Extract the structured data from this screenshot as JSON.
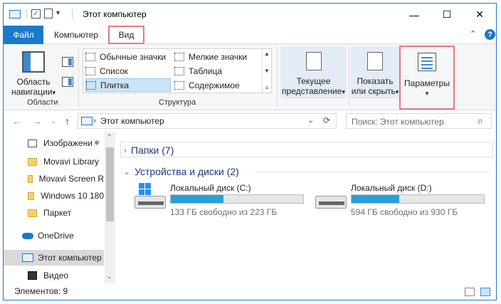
{
  "window": {
    "title": "Этот компьютер",
    "controls": {
      "minimize": "—",
      "maximize": "☐",
      "close": "✕"
    }
  },
  "ribbon_tabs": {
    "file": "Файл",
    "computer": "Компьютер",
    "view": "Вид",
    "collapse_glyph": "⌃",
    "help_glyph": "?"
  },
  "ribbon": {
    "panes_group": {
      "nav_pane_label_1": "Область",
      "nav_pane_label_2": "навигации",
      "dropdown": "▾",
      "group_label": "Области"
    },
    "layout_group": {
      "items": [
        "Обычные значки",
        "Мелкие значки",
        "Список",
        "Таблица",
        "Плитка",
        "Содержимое"
      ],
      "selected": "Плитка",
      "group_label": "Структура"
    },
    "current_view": {
      "label_1": "Текущее",
      "label_2": "представление",
      "dropdown": "▾"
    },
    "show_hide": {
      "label_1": "Показать",
      "label_2": "или скрыть",
      "dropdown": "▾"
    },
    "options": {
      "label": "Параметры",
      "dropdown": "▾"
    }
  },
  "address_bar": {
    "back": "←",
    "forward": "→",
    "recent": "⌄",
    "up": "↑",
    "separator": "›",
    "path": "Этот компьютер",
    "dropdown": "⌄",
    "refresh": "⟳",
    "search_placeholder": "Поиск: Этот компьютер",
    "search_icon": "⌕"
  },
  "sidebar": {
    "items": [
      {
        "label": "Изображени",
        "icon": "pictures-icon",
        "pinned": true
      },
      {
        "label": "Movavi Library",
        "icon": "folder-icon"
      },
      {
        "label": "Movavi Screen R",
        "icon": "folder-icon"
      },
      {
        "label": "Windows 10 180",
        "icon": "folder-icon"
      },
      {
        "label": "Паркет",
        "icon": "folder-icon"
      },
      {
        "label": "OneDrive",
        "icon": "cloud-icon"
      },
      {
        "label": "Этот компьютер",
        "icon": "computer-icon",
        "selected": true
      },
      {
        "label": "Видео",
        "icon": "video-icon"
      }
    ],
    "pin_glyph": "📌",
    "scroll_up": "⌃",
    "scroll_down": "⌄"
  },
  "content": {
    "folders_group": "Папки (7)",
    "devices_group": "Устройства и диски (2)",
    "collapsed_chevron": "›",
    "expanded_chevron": "⌄",
    "drives": [
      {
        "name": "Локальный диск (C:)",
        "free_text": "133 ГБ свободно из 223 ГБ",
        "used_fraction": 0.4,
        "system": true
      },
      {
        "name": "Локальный диск (D:)",
        "free_text": "594 ГБ свободно из 930 ГБ",
        "used_fraction": 0.36,
        "system": false
      }
    ]
  },
  "status_bar": {
    "items_count": "Элементов: 9"
  },
  "colors": {
    "accent": "#1979ca",
    "highlight_box": "#e07a80",
    "drive_fill": "#26a0da",
    "group_heading": "#1e3287"
  }
}
